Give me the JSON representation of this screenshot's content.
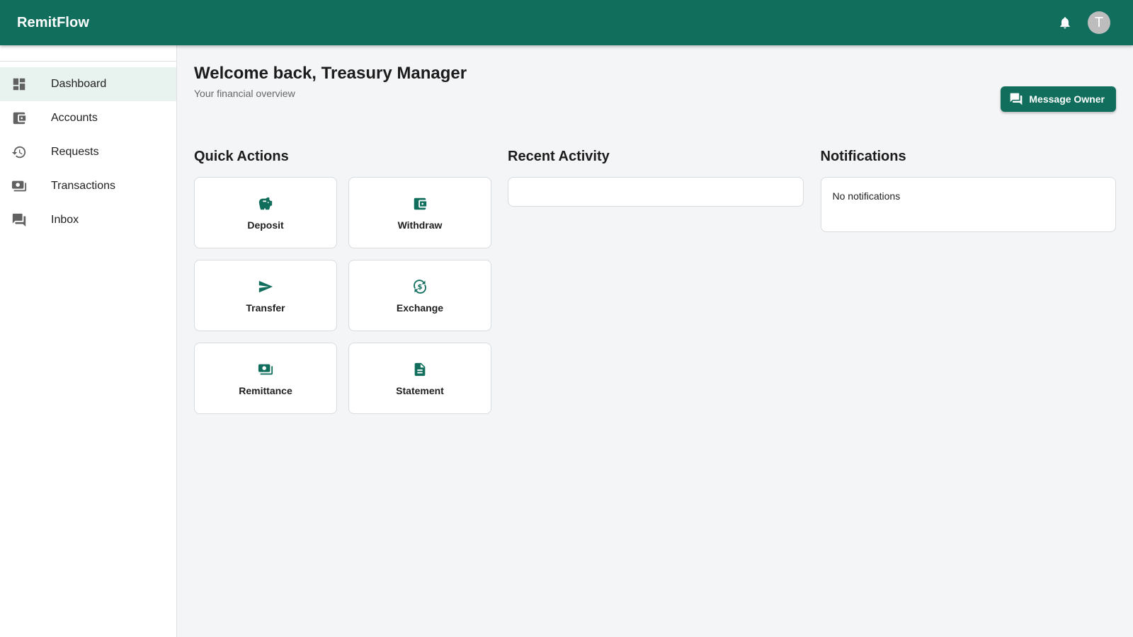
{
  "app": {
    "brand": "RemitFlow",
    "avatar_initial": "T"
  },
  "icons": {
    "bell": "bell-icon",
    "message": "chat-bubbles-icon"
  },
  "colors": {
    "primary": "#116e5d",
    "sidebar_active_bg": "#e8f2ef",
    "page_bg": "#f4f5f7"
  },
  "sidebar": {
    "items": [
      {
        "label": "Dashboard",
        "icon": "dashboard-icon",
        "active": true
      },
      {
        "label": "Accounts",
        "icon": "wallet-icon",
        "active": false
      },
      {
        "label": "Requests",
        "icon": "history-icon",
        "active": false
      },
      {
        "label": "Transactions",
        "icon": "money-icon",
        "active": false
      },
      {
        "label": "Inbox",
        "icon": "chat-bubbles-icon",
        "active": false
      }
    ]
  },
  "header": {
    "title": "Welcome back, Treasury Manager",
    "subtitle": "Your financial overview",
    "message_button": "Message Owner"
  },
  "quick_actions": {
    "title": "Quick Actions",
    "items": [
      {
        "label": "Deposit",
        "icon": "piggy-bank-icon"
      },
      {
        "label": "Withdraw",
        "icon": "wallet-icon"
      },
      {
        "label": "Transfer",
        "icon": "send-icon"
      },
      {
        "label": "Exchange",
        "icon": "currency-exchange-icon"
      },
      {
        "label": "Remittance",
        "icon": "money-icon"
      },
      {
        "label": "Statement",
        "icon": "document-icon"
      }
    ]
  },
  "recent_activity": {
    "title": "Recent Activity"
  },
  "notifications": {
    "title": "Notifications",
    "empty_text": "No notifications"
  }
}
